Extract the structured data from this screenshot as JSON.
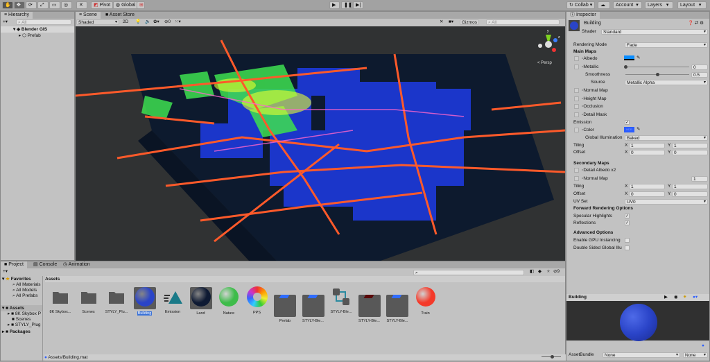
{
  "toolbar": {
    "tools": [
      "hand-tool",
      "move-tool",
      "rotate-tool",
      "scale-tool",
      "rect-tool",
      "transform-tool",
      "custom-tool"
    ],
    "pivot": "Pivot",
    "global": "Global",
    "collab": "Collab",
    "account": "Account",
    "layers": "Layers",
    "layout": "Layout"
  },
  "hierarchy": {
    "title": "Hierarchy",
    "search_placeholder": "All",
    "items": [
      {
        "label": "Blender GIS"
      },
      {
        "label": "Prefab"
      }
    ]
  },
  "scene": {
    "tabs": [
      "Scene",
      "Asset Store"
    ],
    "shading": "Shaded",
    "mode_2d": "2D",
    "fx_count": "0",
    "gizmos": "Gizmos",
    "search_placeholder": "All",
    "persp": "< Persp",
    "axis_y": "y",
    "axis_z": "z",
    "colors": {
      "roads": "#ff5a2a",
      "buildings": "#2040ff",
      "parks": "#3ee050",
      "ground": "#0d1a2e"
    }
  },
  "inspector": {
    "title": "Inspector",
    "object_name": "Building",
    "shader_label": "Shader",
    "shader": "Standard",
    "rendering_mode_label": "Rendering Mode",
    "rendering_mode": "Fade",
    "main_maps": "Main Maps",
    "albedo": "Albedo",
    "albedo_color": "#0a8cff",
    "metallic": "Metallic",
    "metallic_value": "0",
    "smoothness": "Smoothness",
    "smoothness_value": "0.5",
    "source_label": "Source",
    "source": "Metallic Alpha",
    "normal_map": "Normal Map",
    "height_map": "Height Map",
    "occlusion": "Occlusion",
    "detail_mask": "Detail Mask",
    "emission": "Emission",
    "emission_checked": true,
    "color": "Color",
    "emission_color": "#2a5cff",
    "emission_hdr": "HDR",
    "gi_label": "Global Illumination",
    "gi": "Baked",
    "tiling": "Tiling",
    "offset": "Offset",
    "x": "X",
    "y": "Y",
    "tiling_x": "1",
    "tiling_y": "1",
    "offset_x": "0",
    "offset_y": "0",
    "secondary_maps": "Secondary Maps",
    "detail_albedo": "Detail Albedo x2",
    "normal_map2": "Normal Map",
    "normal_scale": "1",
    "tiling2_x": "1",
    "tiling2_y": "1",
    "offset2_x": "0",
    "offset2_y": "0",
    "uv_set_label": "UV Set",
    "uv_set": "UV0",
    "forward": "Forward Rendering Options",
    "specular": "Specular Highlights",
    "specular_checked": true,
    "reflections": "Reflections",
    "reflections_checked": true,
    "advanced": "Advanced Options",
    "gpu": "Enable GPU Instancing",
    "gpu_checked": false,
    "double_sided": "Double Sided Global Illu",
    "double_checked": false,
    "preview_title": "Building",
    "assetbundle_label": "AssetBundle",
    "assetbundle": "None",
    "variant": "None"
  },
  "project": {
    "tabs": [
      "Project",
      "Console",
      "Animation"
    ],
    "favorites": "Favorites",
    "fav_items": [
      "All Materials",
      "All Models",
      "All Prefabs"
    ],
    "assets_root": "Assets",
    "asset_folders": [
      "8K Skybox P",
      "Scenes",
      "STYLY_Plug"
    ],
    "packages": "Packages",
    "breadcrumb": "Assets",
    "hidden_count": "9",
    "status_path": "Assets/Building.mat",
    "assets": [
      {
        "label": "8K Skybox...",
        "type": "folder"
      },
      {
        "label": "Scenes",
        "type": "folder"
      },
      {
        "label": "STYLY_Plu...",
        "type": "folder"
      },
      {
        "label": "Building",
        "type": "material",
        "color": "#2a44c8",
        "selected": true
      },
      {
        "label": "Emission",
        "type": "emission"
      },
      {
        "label": "Land",
        "type": "material",
        "color": "#0e1a33"
      },
      {
        "label": "Nature",
        "type": "material",
        "color": "#3ebc4a"
      },
      {
        "label": "PPS",
        "type": "pps"
      },
      {
        "label": "Prefab",
        "type": "prefab"
      },
      {
        "label": "STYLY-Ble...",
        "type": "prefab"
      },
      {
        "label": "STYLY-Ble...",
        "type": "prefab-variant"
      },
      {
        "label": "STYLY-Ble...",
        "type": "model"
      },
      {
        "label": "STYLY-Ble...",
        "type": "prefab"
      },
      {
        "label": "Train",
        "type": "material",
        "color": "#f43a2a"
      }
    ]
  }
}
